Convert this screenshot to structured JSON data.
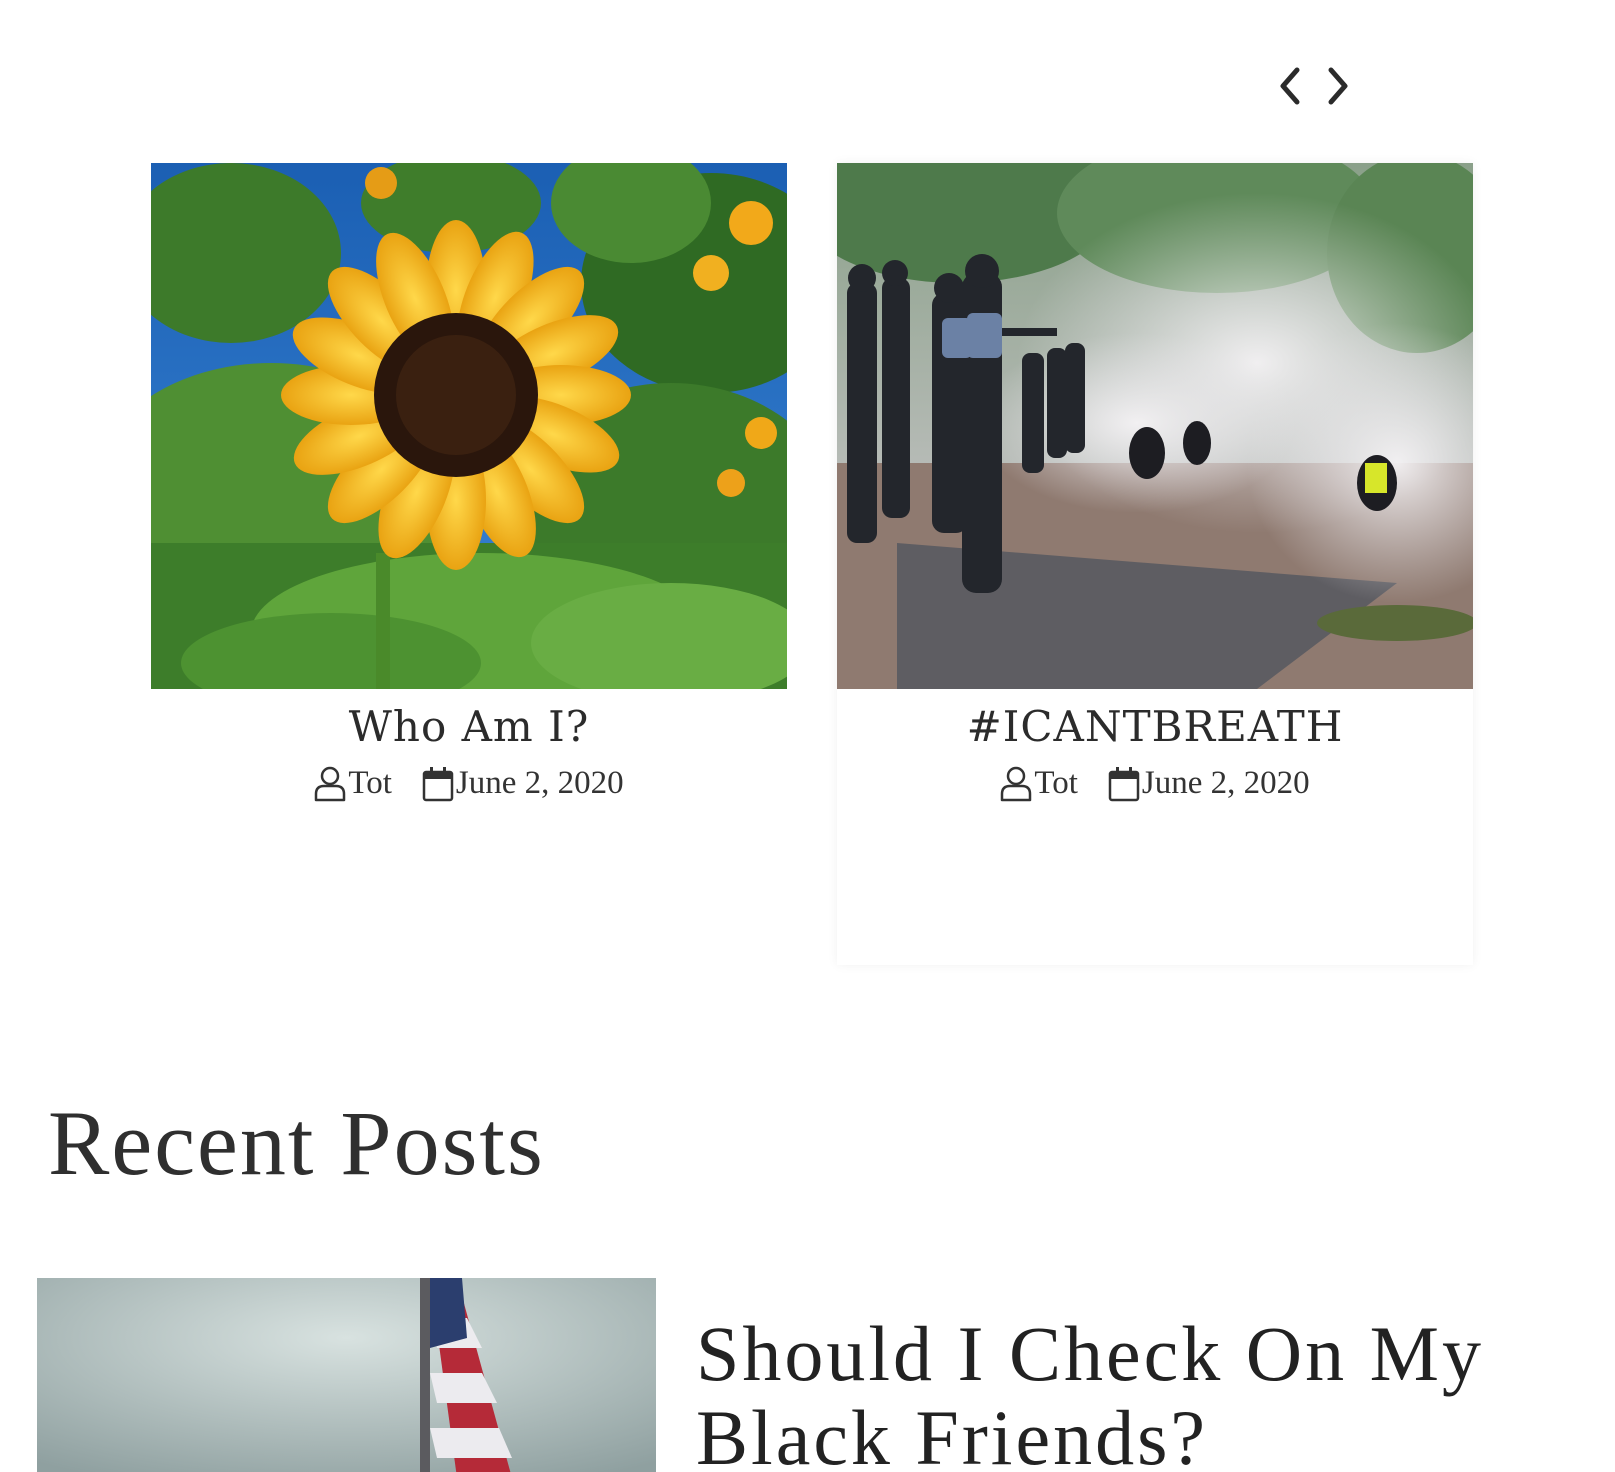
{
  "carousel": {
    "prev_icon": "chevron-left-icon",
    "next_icon": "chevron-right-icon"
  },
  "featured": [
    {
      "title": "Who Am I?",
      "author": "Tot",
      "date": "June 2, 2020",
      "image": "sunflower-photo"
    },
    {
      "title": "#ICANTBREATH",
      "author": "Tot",
      "date": "June 2, 2020",
      "image": "protest-photo"
    }
  ],
  "recent": {
    "heading": "Recent Posts",
    "posts": [
      {
        "title": "Should I Check On My Black Friends?",
        "image": "american-flag-photo"
      }
    ]
  },
  "icons": {
    "author": "user-icon",
    "date": "calendar-icon"
  },
  "colors": {
    "text": "#2b2b2b",
    "background": "#ffffff"
  }
}
